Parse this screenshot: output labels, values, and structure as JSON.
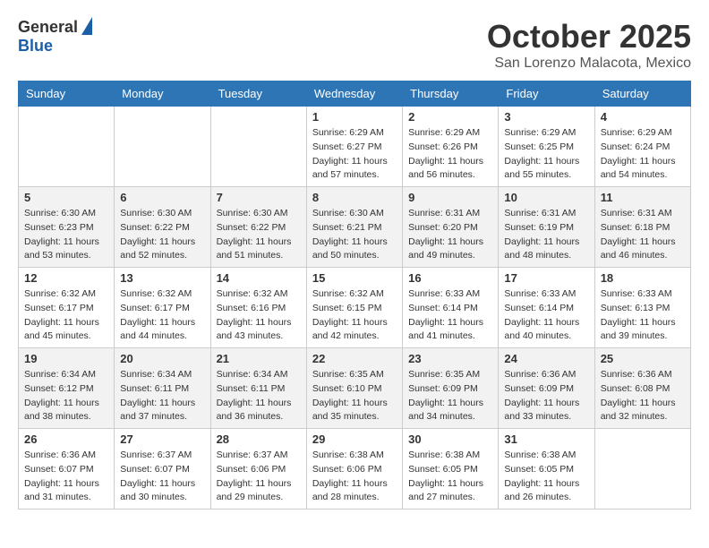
{
  "logo": {
    "general": "General",
    "blue": "Blue"
  },
  "header": {
    "month": "October 2025",
    "location": "San Lorenzo Malacota, Mexico"
  },
  "weekdays": [
    "Sunday",
    "Monday",
    "Tuesday",
    "Wednesday",
    "Thursday",
    "Friday",
    "Saturday"
  ],
  "weeks": [
    [
      {
        "day": "",
        "info": ""
      },
      {
        "day": "",
        "info": ""
      },
      {
        "day": "",
        "info": ""
      },
      {
        "day": "1",
        "sunrise": "6:29 AM",
        "sunset": "6:27 PM",
        "daylight": "11 hours and 57 minutes."
      },
      {
        "day": "2",
        "sunrise": "6:29 AM",
        "sunset": "6:26 PM",
        "daylight": "11 hours and 56 minutes."
      },
      {
        "day": "3",
        "sunrise": "6:29 AM",
        "sunset": "6:25 PM",
        "daylight": "11 hours and 55 minutes."
      },
      {
        "day": "4",
        "sunrise": "6:29 AM",
        "sunset": "6:24 PM",
        "daylight": "11 hours and 54 minutes."
      }
    ],
    [
      {
        "day": "5",
        "sunrise": "6:30 AM",
        "sunset": "6:23 PM",
        "daylight": "11 hours and 53 minutes."
      },
      {
        "day": "6",
        "sunrise": "6:30 AM",
        "sunset": "6:22 PM",
        "daylight": "11 hours and 52 minutes."
      },
      {
        "day": "7",
        "sunrise": "6:30 AM",
        "sunset": "6:22 PM",
        "daylight": "11 hours and 51 minutes."
      },
      {
        "day": "8",
        "sunrise": "6:30 AM",
        "sunset": "6:21 PM",
        "daylight": "11 hours and 50 minutes."
      },
      {
        "day": "9",
        "sunrise": "6:31 AM",
        "sunset": "6:20 PM",
        "daylight": "11 hours and 49 minutes."
      },
      {
        "day": "10",
        "sunrise": "6:31 AM",
        "sunset": "6:19 PM",
        "daylight": "11 hours and 48 minutes."
      },
      {
        "day": "11",
        "sunrise": "6:31 AM",
        "sunset": "6:18 PM",
        "daylight": "11 hours and 46 minutes."
      }
    ],
    [
      {
        "day": "12",
        "sunrise": "6:32 AM",
        "sunset": "6:17 PM",
        "daylight": "11 hours and 45 minutes."
      },
      {
        "day": "13",
        "sunrise": "6:32 AM",
        "sunset": "6:17 PM",
        "daylight": "11 hours and 44 minutes."
      },
      {
        "day": "14",
        "sunrise": "6:32 AM",
        "sunset": "6:16 PM",
        "daylight": "11 hours and 43 minutes."
      },
      {
        "day": "15",
        "sunrise": "6:32 AM",
        "sunset": "6:15 PM",
        "daylight": "11 hours and 42 minutes."
      },
      {
        "day": "16",
        "sunrise": "6:33 AM",
        "sunset": "6:14 PM",
        "daylight": "11 hours and 41 minutes."
      },
      {
        "day": "17",
        "sunrise": "6:33 AM",
        "sunset": "6:14 PM",
        "daylight": "11 hours and 40 minutes."
      },
      {
        "day": "18",
        "sunrise": "6:33 AM",
        "sunset": "6:13 PM",
        "daylight": "11 hours and 39 minutes."
      }
    ],
    [
      {
        "day": "19",
        "sunrise": "6:34 AM",
        "sunset": "6:12 PM",
        "daylight": "11 hours and 38 minutes."
      },
      {
        "day": "20",
        "sunrise": "6:34 AM",
        "sunset": "6:11 PM",
        "daylight": "11 hours and 37 minutes."
      },
      {
        "day": "21",
        "sunrise": "6:34 AM",
        "sunset": "6:11 PM",
        "daylight": "11 hours and 36 minutes."
      },
      {
        "day": "22",
        "sunrise": "6:35 AM",
        "sunset": "6:10 PM",
        "daylight": "11 hours and 35 minutes."
      },
      {
        "day": "23",
        "sunrise": "6:35 AM",
        "sunset": "6:09 PM",
        "daylight": "11 hours and 34 minutes."
      },
      {
        "day": "24",
        "sunrise": "6:36 AM",
        "sunset": "6:09 PM",
        "daylight": "11 hours and 33 minutes."
      },
      {
        "day": "25",
        "sunrise": "6:36 AM",
        "sunset": "6:08 PM",
        "daylight": "11 hours and 32 minutes."
      }
    ],
    [
      {
        "day": "26",
        "sunrise": "6:36 AM",
        "sunset": "6:07 PM",
        "daylight": "11 hours and 31 minutes."
      },
      {
        "day": "27",
        "sunrise": "6:37 AM",
        "sunset": "6:07 PM",
        "daylight": "11 hours and 30 minutes."
      },
      {
        "day": "28",
        "sunrise": "6:37 AM",
        "sunset": "6:06 PM",
        "daylight": "11 hours and 29 minutes."
      },
      {
        "day": "29",
        "sunrise": "6:38 AM",
        "sunset": "6:06 PM",
        "daylight": "11 hours and 28 minutes."
      },
      {
        "day": "30",
        "sunrise": "6:38 AM",
        "sunset": "6:05 PM",
        "daylight": "11 hours and 27 minutes."
      },
      {
        "day": "31",
        "sunrise": "6:38 AM",
        "sunset": "6:05 PM",
        "daylight": "11 hours and 26 minutes."
      },
      {
        "day": "",
        "info": ""
      }
    ]
  ],
  "labels": {
    "sunrise": "Sunrise:",
    "sunset": "Sunset:",
    "daylight": "Daylight:"
  }
}
